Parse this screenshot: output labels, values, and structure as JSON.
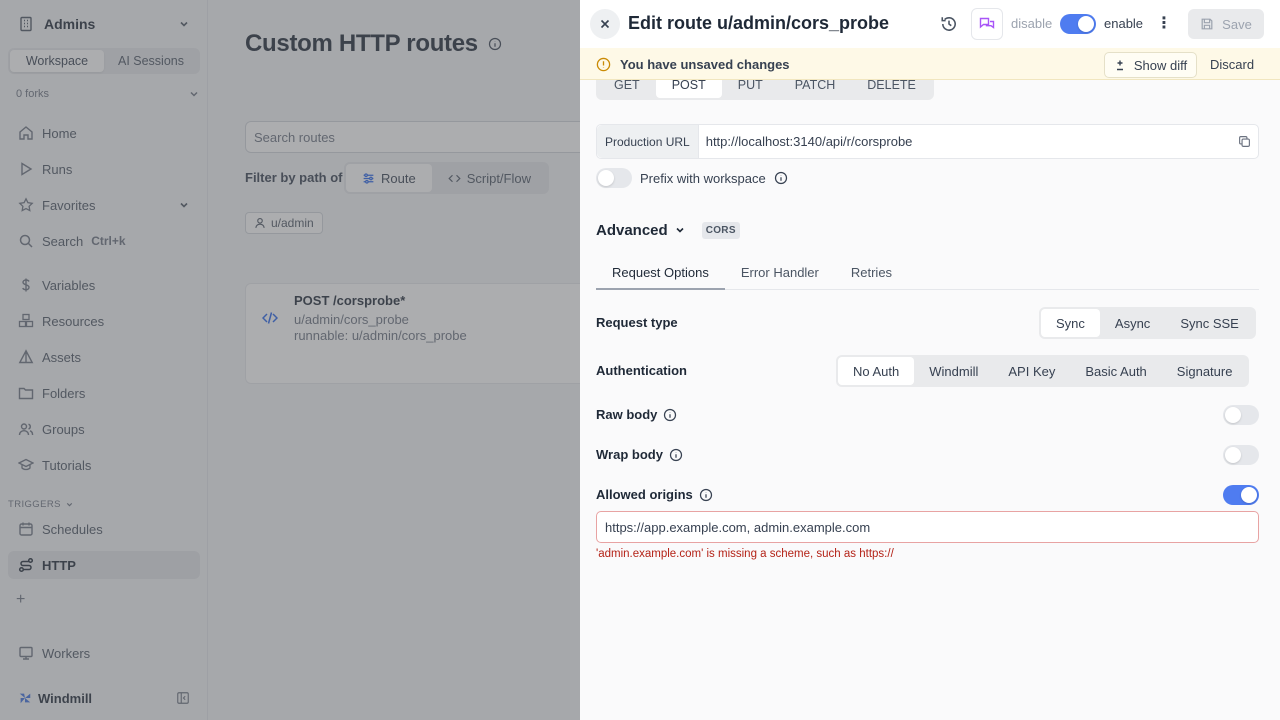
{
  "sidebar": {
    "workspace_name": "Admins",
    "tabs": [
      "Workspace",
      "AI Sessions"
    ],
    "forks": "0 forks",
    "items": [
      {
        "label": "Home"
      },
      {
        "label": "Runs"
      },
      {
        "label": "Favorites"
      },
      {
        "label": "Search",
        "shortcut": "Ctrl+k"
      },
      {
        "label": "Variables"
      },
      {
        "label": "Resources"
      },
      {
        "label": "Assets"
      },
      {
        "label": "Folders"
      },
      {
        "label": "Groups"
      },
      {
        "label": "Tutorials"
      }
    ],
    "triggers_label": "TRIGGERS",
    "trigger_items": [
      {
        "label": "Schedules"
      },
      {
        "label": "HTTP"
      }
    ],
    "workers_label": "Workers",
    "brand": "Windmill"
  },
  "page": {
    "title": "Custom HTTP routes",
    "search_placeholder": "Search routes",
    "filter_label": "Filter by path of",
    "filter_options": [
      "Route",
      "Script/Flow"
    ],
    "owner_chip": "u/admin",
    "route": {
      "title": "POST /corsprobe*",
      "path": "u/admin/cors_probe",
      "runnable": "runnable: u/admin/cors_probe"
    }
  },
  "drawer": {
    "title": "Edit route u/admin/cors_probe",
    "disable_label": "disable",
    "enable_label": "enable",
    "enabled": true,
    "save_label": "Save",
    "banner": {
      "message": "You have unsaved changes",
      "show_diff": "Show diff",
      "discard": "Discard"
    },
    "methods": [
      "GET",
      "POST",
      "PUT",
      "PATCH",
      "DELETE"
    ],
    "selected_method": "POST",
    "url_label": "Production URL",
    "url_value": "http://localhost:3140/api/r/corsprobe",
    "prefix_label": "Prefix with workspace",
    "prefix_enabled": false,
    "advanced_label": "Advanced",
    "cors_badge": "CORS",
    "tabs": [
      "Request Options",
      "Error Handler",
      "Retries"
    ],
    "active_tab": "Request Options",
    "request_type": {
      "label": "Request type",
      "options": [
        "Sync",
        "Async",
        "Sync SSE"
      ],
      "selected": "Sync"
    },
    "authentication": {
      "label": "Authentication",
      "options": [
        "No Auth",
        "Windmill",
        "API Key",
        "Basic Auth",
        "Signature"
      ],
      "selected": "No Auth"
    },
    "raw_body": {
      "label": "Raw body",
      "enabled": false
    },
    "wrap_body": {
      "label": "Wrap body",
      "enabled": false
    },
    "allowed_origins": {
      "label": "Allowed origins",
      "enabled": true,
      "value": "https://app.example.com, admin.example.com",
      "error": "'admin.example.com' is missing a scheme, such as https://"
    }
  },
  "colors": {
    "accent": "#4f7cf0",
    "warning_bg": "#fef9e7",
    "error": "#b42318"
  }
}
